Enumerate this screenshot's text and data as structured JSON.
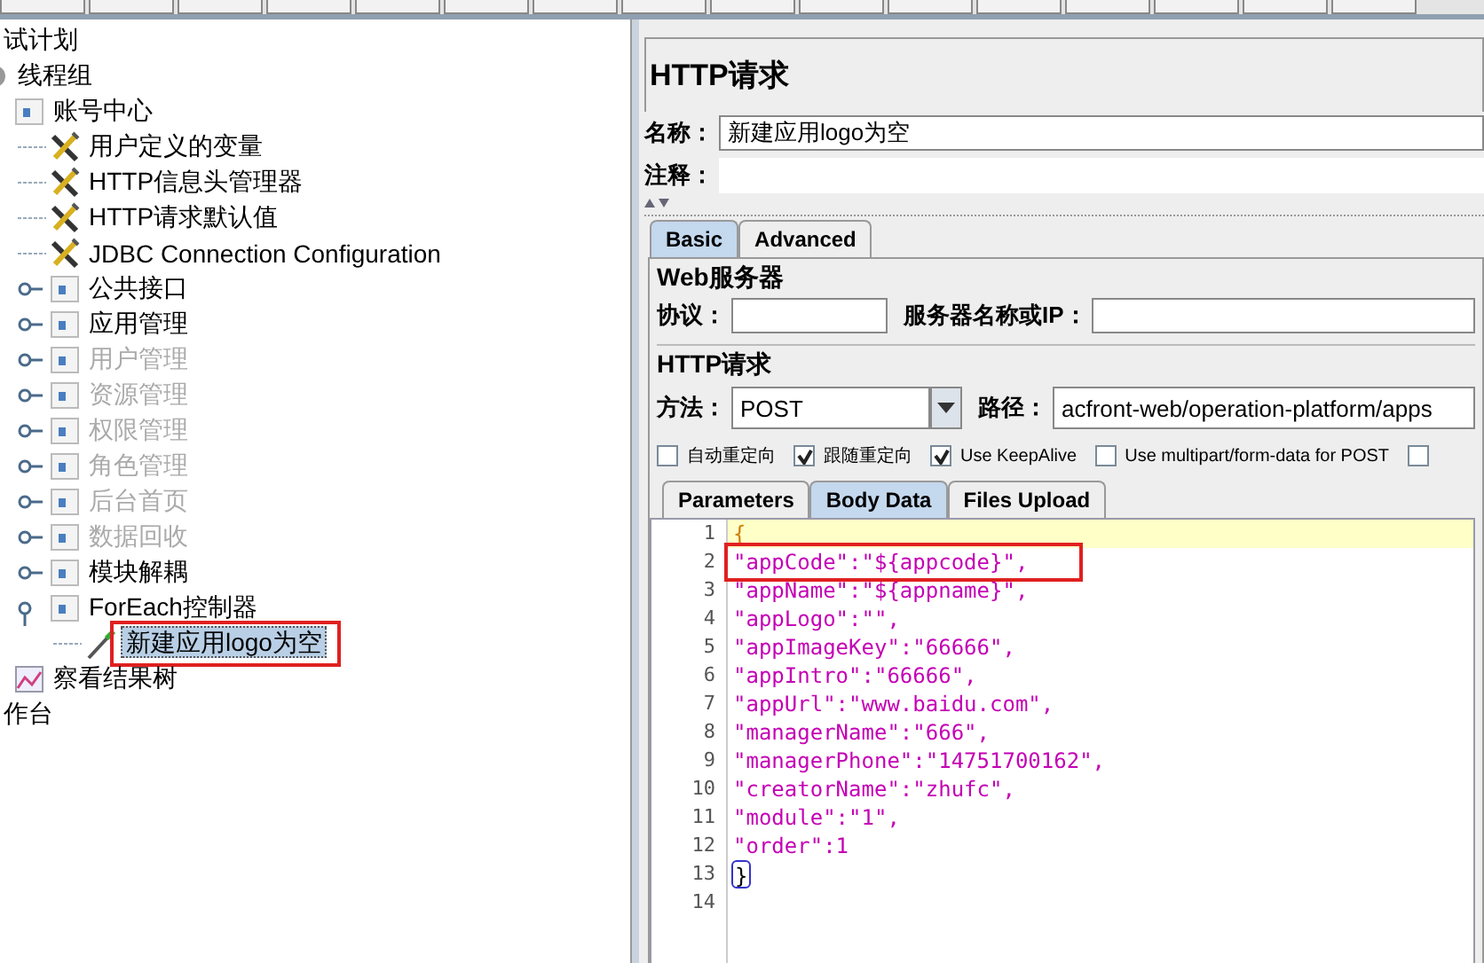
{
  "tree": [
    {
      "label": "试计划",
      "kind": "none",
      "disabled": false,
      "selected": false,
      "outlined": false,
      "children": [
        {
          "label": "线程组",
          "kind": "thread-group",
          "disabled": false,
          "selected": false,
          "outlined": false,
          "children": [
            {
              "label": "账号中心",
              "kind": "controller",
              "disabled": false,
              "selected": false,
              "outlined": false,
              "children": [
                {
                  "label": "用户定义的变量",
                  "kind": "config",
                  "disabled": false,
                  "selected": false,
                  "outlined": false
                },
                {
                  "label": "HTTP信息头管理器",
                  "kind": "config",
                  "disabled": false,
                  "selected": false,
                  "outlined": false
                },
                {
                  "label": "HTTP请求默认值",
                  "kind": "config",
                  "disabled": false,
                  "selected": false,
                  "outlined": false
                },
                {
                  "label": "JDBC Connection Configuration",
                  "kind": "config",
                  "disabled": false,
                  "selected": false,
                  "outlined": false
                },
                {
                  "label": "公共接口",
                  "kind": "controller",
                  "disabled": false,
                  "selected": false,
                  "outlined": false,
                  "expanded": false
                },
                {
                  "label": "应用管理",
                  "kind": "controller",
                  "disabled": false,
                  "selected": false,
                  "outlined": false,
                  "expanded": false
                },
                {
                  "label": "用户管理",
                  "kind": "controller",
                  "disabled": true,
                  "selected": false,
                  "outlined": false,
                  "expanded": false
                },
                {
                  "label": "资源管理",
                  "kind": "controller",
                  "disabled": true,
                  "selected": false,
                  "outlined": false,
                  "expanded": false
                },
                {
                  "label": "权限管理",
                  "kind": "controller",
                  "disabled": true,
                  "selected": false,
                  "outlined": false,
                  "expanded": false
                },
                {
                  "label": "角色管理",
                  "kind": "controller",
                  "disabled": true,
                  "selected": false,
                  "outlined": false,
                  "expanded": false
                },
                {
                  "label": "后台首页",
                  "kind": "controller",
                  "disabled": true,
                  "selected": false,
                  "outlined": false,
                  "expanded": false
                },
                {
                  "label": "数据回收",
                  "kind": "controller",
                  "disabled": true,
                  "selected": false,
                  "outlined": false,
                  "expanded": false
                },
                {
                  "label": "模块解耦",
                  "kind": "controller",
                  "disabled": false,
                  "selected": false,
                  "outlined": false,
                  "expanded": false
                },
                {
                  "label": "ForEach控制器",
                  "kind": "controller",
                  "disabled": false,
                  "selected": false,
                  "outlined": false,
                  "expanded": true,
                  "children": [
                    {
                      "label": "新建应用logo为空",
                      "kind": "sampler",
                      "disabled": false,
                      "selected": true,
                      "outlined": true
                    }
                  ]
                }
              ]
            },
            {
              "label": "察看结果树",
              "kind": "listener",
              "disabled": false,
              "selected": false,
              "outlined": false
            }
          ]
        }
      ]
    },
    {
      "label": "作台",
      "kind": "none",
      "disabled": false,
      "selected": false,
      "outlined": false
    }
  ],
  "panel": {
    "title": "HTTP请求",
    "name_label": "名称：",
    "name_value": "新建应用logo为空",
    "comment_label": "注释：",
    "tabs": [
      {
        "label": "Basic",
        "selected": true
      },
      {
        "label": "Advanced",
        "selected": false
      }
    ],
    "web_server": {
      "legend": "Web服务器",
      "protocol_label": "协议：",
      "server_label": "服务器名称或IP："
    },
    "http_request": {
      "legend": "HTTP请求",
      "method_label": "方法：",
      "method_value": "POST",
      "path_label": "路径：",
      "path_value": "acfront-web/operation-platform/apps",
      "options": [
        {
          "label": "自动重定向",
          "checked": false
        },
        {
          "label": "跟随重定向",
          "checked": true
        },
        {
          "label": "Use KeepAlive",
          "checked": true
        },
        {
          "label": "Use multipart/form-data for POST",
          "checked": false
        },
        {
          "checked": false
        }
      ]
    },
    "body_tabs": [
      {
        "label": "Parameters",
        "selected": false
      },
      {
        "label": "Body Data",
        "selected": true
      },
      {
        "label": "Files Upload",
        "selected": false
      }
    ],
    "editor": {
      "lines": [
        {
          "number": "1",
          "text": "{",
          "kind": "brace",
          "current": true,
          "outlined": false
        },
        {
          "number": "2",
          "text": "\"appCode\":\"${appcode}\",",
          "kind": "code",
          "current": false,
          "outlined": true
        },
        {
          "number": "3",
          "text": "\"appName\":\"${appname}\",",
          "kind": "code",
          "current": false,
          "outlined": false
        },
        {
          "number": "4",
          "text": "\"appLogo\":\"\",",
          "kind": "code",
          "current": false,
          "outlined": false
        },
        {
          "number": "5",
          "text": "\"appImageKey\":\"66666\",",
          "kind": "code",
          "current": false,
          "outlined": false
        },
        {
          "number": "6",
          "text": "\"appIntro\":\"66666\",",
          "kind": "code",
          "current": false,
          "outlined": false
        },
        {
          "number": "7",
          "text": "\"appUrl\":\"www.baidu.com\",",
          "kind": "code",
          "current": false,
          "outlined": false
        },
        {
          "number": "8",
          "text": "\"managerName\":\"666\",",
          "kind": "code",
          "current": false,
          "outlined": false
        },
        {
          "number": "9",
          "text": "\"managerPhone\":\"14751700162\",",
          "kind": "code",
          "current": false,
          "outlined": false
        },
        {
          "number": "10",
          "text": "\"creatorName\":\"zhufc\",",
          "kind": "code",
          "current": false,
          "outlined": false
        },
        {
          "number": "11",
          "text": "\"module\":\"1\",",
          "kind": "code",
          "current": false,
          "outlined": false
        },
        {
          "number": "12",
          "text": "\"order\":1",
          "kind": "code",
          "current": false,
          "outlined": false
        },
        {
          "number": "13",
          "text": "}",
          "kind": "matched-brace",
          "current": false,
          "outlined": false
        },
        {
          "number": "14",
          "kind": "code",
          "current": false,
          "outlined": false
        }
      ]
    }
  }
}
